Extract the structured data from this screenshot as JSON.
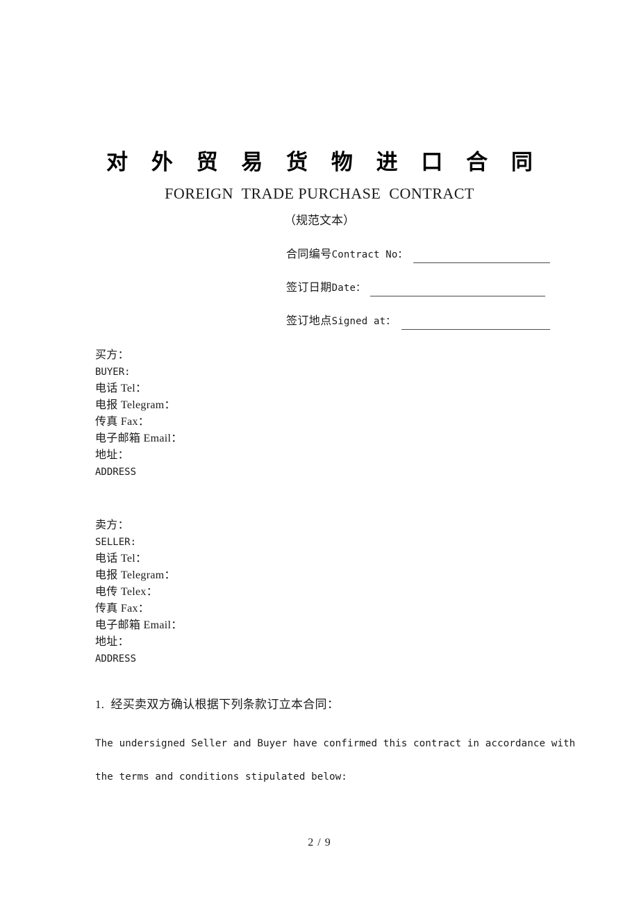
{
  "document": {
    "title_cn": "对 外 贸 易 货 物 进 口 合 同",
    "title_en": "FOREIGN  TRADE PURCHASE  CONTRACT",
    "subtitle_cn": "（规范文本）"
  },
  "meta_fields": [
    {
      "label_cn": "合同编号",
      "label_en": "Contract No：",
      "value": ""
    },
    {
      "label_cn": "签订日期",
      "label_en": "Date：",
      "value": ""
    },
    {
      "label_cn": "签订地点",
      "label_en": "Signed at：",
      "value": ""
    }
  ],
  "buyer": {
    "lines": [
      "买方：",
      "BUYER:",
      "电话 Tel：",
      "电报 Telegram：",
      "传真 Fax：",
      "电子邮箱 Email：",
      "地址：",
      "ADDRESS"
    ]
  },
  "seller": {
    "lines": [
      "卖方：",
      "SELLER:",
      "电话 Tel：",
      "电报 Telegram：",
      "电传 Telex：",
      "传真 Fax：",
      "电子邮箱 Email：",
      "地址：",
      "ADDRESS"
    ]
  },
  "clause": {
    "number_cn": "1.  经买卖双方确认根据下列条款订立本合同：",
    "english_line_1": "The undersigned Seller and Buyer have confirmed this contract in accordance with",
    "english_line_2": "the terms and conditions stipulated below:"
  },
  "footer": {
    "page_label": "2 / 9"
  },
  "colors": {
    "page_background": "#ffffff",
    "text": "#1a1a1a",
    "rule": "#4a4a4a"
  }
}
